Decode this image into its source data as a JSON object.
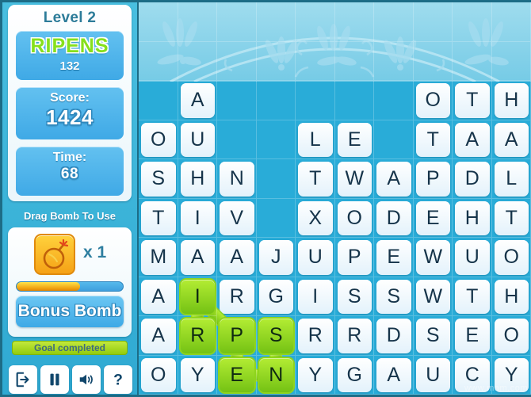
{
  "sidebar": {
    "level_label": "Level 2",
    "found_word": "RIPENS",
    "found_word_points": "132",
    "score_label": "Score:",
    "score_value": "1424",
    "time_label": "Time:",
    "time_value": "68",
    "drag_hint": "Drag Bomb To Use",
    "bomb_icon_name": "bomb-icon",
    "bomb_count": "x 1",
    "bonus_progress_percent": 60,
    "bonus_button_label": "Bonus Bomb",
    "goal_badge_label": "Goal completed",
    "controls": [
      {
        "name": "exit-button",
        "label": "Exit"
      },
      {
        "name": "pause-button",
        "label": "Pause"
      },
      {
        "name": "sound-button",
        "label": "Sound"
      },
      {
        "name": "help-button",
        "label": "Help"
      }
    ]
  },
  "board": {
    "rows": 10,
    "cols": 10,
    "watermark": "www.mam.com",
    "decorative_rows": 2,
    "letters": [
      [
        "",
        "",
        "",
        "",
        "",
        "",
        "",
        "",
        "",
        ""
      ],
      [
        "",
        "",
        "",
        "",
        "",
        "",
        "",
        "",
        "",
        ""
      ],
      [
        "",
        "A",
        "",
        "",
        "",
        "",
        "",
        "O",
        "T",
        "H"
      ],
      [
        "O",
        "U",
        "",
        "",
        "L",
        "E",
        "",
        "T",
        "A",
        "A"
      ],
      [
        "S",
        "H",
        "N",
        "",
        "T",
        "W",
        "A",
        "P",
        "D",
        "L"
      ],
      [
        "T",
        "I",
        "V",
        "",
        "X",
        "O",
        "D",
        "E",
        "H",
        "T"
      ],
      [
        "M",
        "A",
        "A",
        "J",
        "U",
        "P",
        "E",
        "W",
        "U",
        "O"
      ],
      [
        "A",
        "I",
        "R",
        "G",
        "I",
        "S",
        "S",
        "W",
        "T",
        "H"
      ],
      [
        "A",
        "R",
        "P",
        "S",
        "R",
        "R",
        "D",
        "S",
        "E",
        "O"
      ],
      [
        "O",
        "Y",
        "E",
        "N",
        "Y",
        "G",
        "A",
        "U",
        "C",
        "Y"
      ]
    ],
    "selected_path": [
      {
        "row": 8,
        "col": 1,
        "letter": "R"
      },
      {
        "row": 7,
        "col": 1,
        "letter": "I"
      },
      {
        "row": 8,
        "col": 2,
        "letter": "P"
      },
      {
        "row": 9,
        "col": 2,
        "letter": "E"
      },
      {
        "row": 9,
        "col": 3,
        "letter": "N"
      },
      {
        "row": 8,
        "col": 3,
        "letter": "S"
      }
    ]
  },
  "colors": {
    "board_bg": "#29acd8",
    "tile": "#eef7fc",
    "tile_selected": "#8ed41d",
    "panel_blue": "#4fb4e8",
    "word_green": "#86e01c",
    "goal_green": "#a8d91b",
    "bomb_gold": "#f5a216",
    "border_teal": "#1d6c86"
  }
}
